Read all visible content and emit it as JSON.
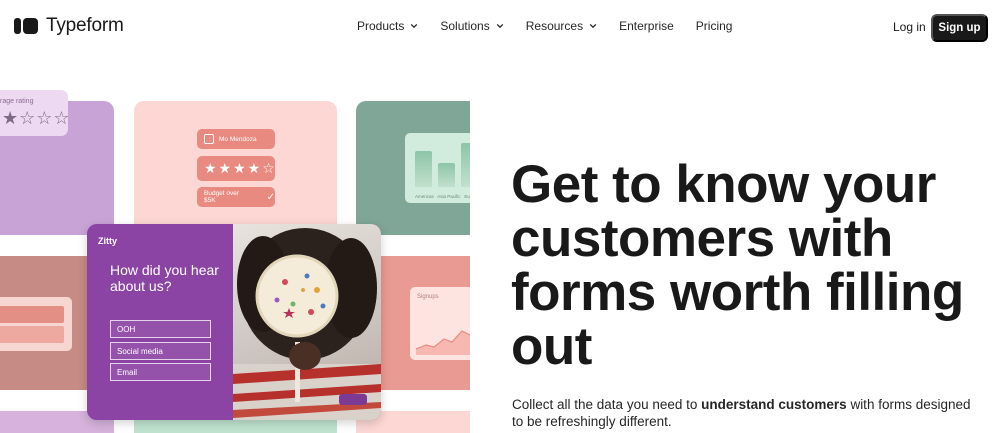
{
  "brand": {
    "name": "Typeform"
  },
  "nav": {
    "items": [
      {
        "label": "Products",
        "has_dropdown": true
      },
      {
        "label": "Solutions",
        "has_dropdown": true
      },
      {
        "label": "Resources",
        "has_dropdown": true
      },
      {
        "label": "Enterprise",
        "has_dropdown": false
      },
      {
        "label": "Pricing",
        "has_dropdown": false
      }
    ],
    "login_label": "Log in",
    "signup_label": "Sign up"
  },
  "collage": {
    "rating_card_label": "rage rating",
    "rating_stars": "★☆☆☆",
    "name_pill": "Mo Mendoza",
    "stars_pill": "★★★★☆",
    "budget_pill": "Budget over $5K",
    "barchart_labels": [
      "Americas",
      "Asia Pacific",
      "Eu"
    ],
    "signups_label": "Signups",
    "form": {
      "brand": "Zitty",
      "question": "How did you hear about us?",
      "options": [
        "OOH",
        "Social media",
        "Email"
      ]
    }
  },
  "hero": {
    "title": "Get to know your customers with forms worth filling out",
    "subtitle_prefix": "Collect all the data you need to ",
    "subtitle_bold": "understand customers",
    "subtitle_suffix": " with forms designed to be refreshingly different."
  },
  "colors": {
    "ink": "#191919",
    "form_purple": "#8b44a4",
    "tile_pink": "#fcd7d3",
    "tile_green": "#7fa697",
    "tile_coral": "#e99a92",
    "tile_purple": "#c8a4d6"
  }
}
